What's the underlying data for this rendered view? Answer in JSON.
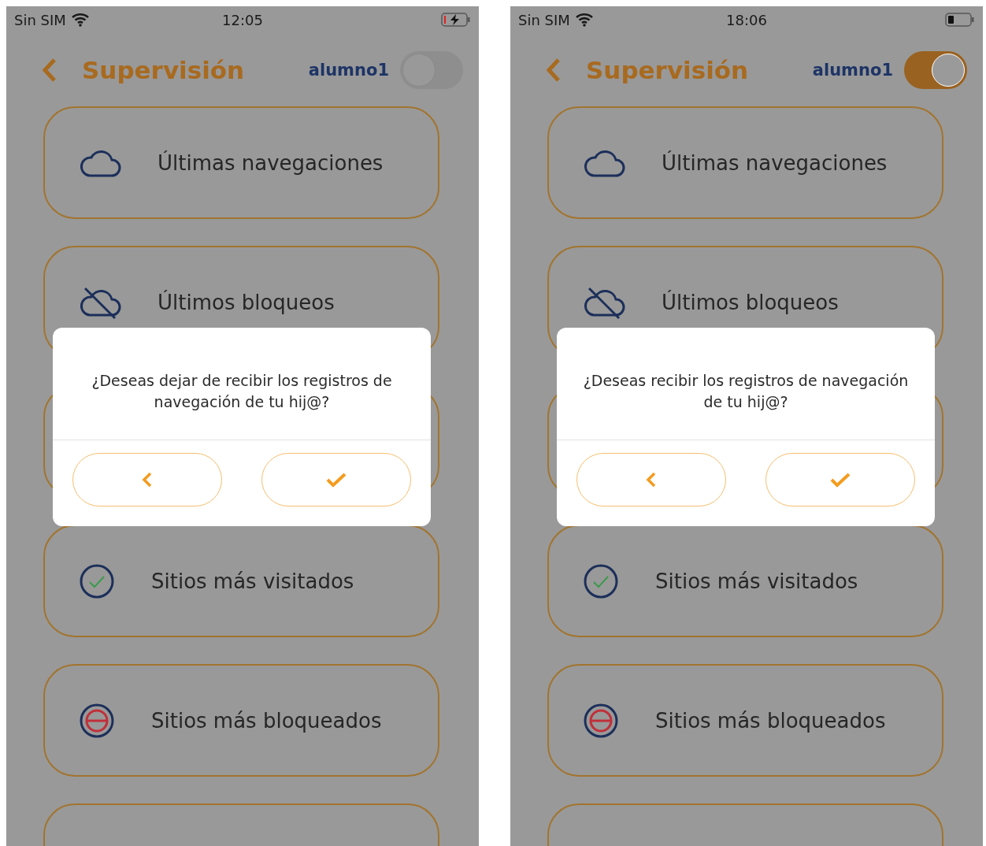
{
  "screens": [
    {
      "status_bar": {
        "carrier": "Sin SIM",
        "time": "12:05",
        "charging": true
      },
      "header": {
        "title": "Supervisión",
        "user": "alumno1",
        "on": false
      },
      "menu": [
        {
          "label": "Últimas navegaciones",
          "kind": "cloud"
        },
        {
          "label": "Últimos bloqueos",
          "kind": "cloud-off"
        },
        {
          "kind": "covered"
        },
        {
          "label": "Sitios más visitados",
          "kind": "check"
        },
        {
          "label": "Sitios más bloqueados",
          "kind": "blocked"
        },
        {
          "kind": "covered"
        }
      ],
      "dialog": {
        "message": "¿Deseas dejar de recibir los registros de navegación de tu hij@?",
        "buttons": [
          {
            "kind": "back"
          },
          {
            "kind": "confirm"
          }
        ]
      }
    },
    {
      "status_bar": {
        "carrier": "Sin SIM",
        "time": "18:06",
        "charging": false
      },
      "header": {
        "title": "Supervisión",
        "user": "alumno1",
        "on": true
      },
      "menu": [
        {
          "label": "Últimas navegaciones",
          "kind": "cloud"
        },
        {
          "label": "Últimos bloqueos",
          "kind": "cloud-off"
        },
        {
          "kind": "covered"
        },
        {
          "label": "Sitios más visitados",
          "kind": "check"
        },
        {
          "label": "Sitios más bloqueados",
          "kind": "blocked"
        },
        {
          "kind": "covered"
        }
      ],
      "dialog": {
        "message": "¿Deseas recibir los registros de navegación de tu hij@?",
        "buttons": [
          {
            "kind": "back"
          },
          {
            "kind": "confirm"
          }
        ]
      }
    }
  ]
}
